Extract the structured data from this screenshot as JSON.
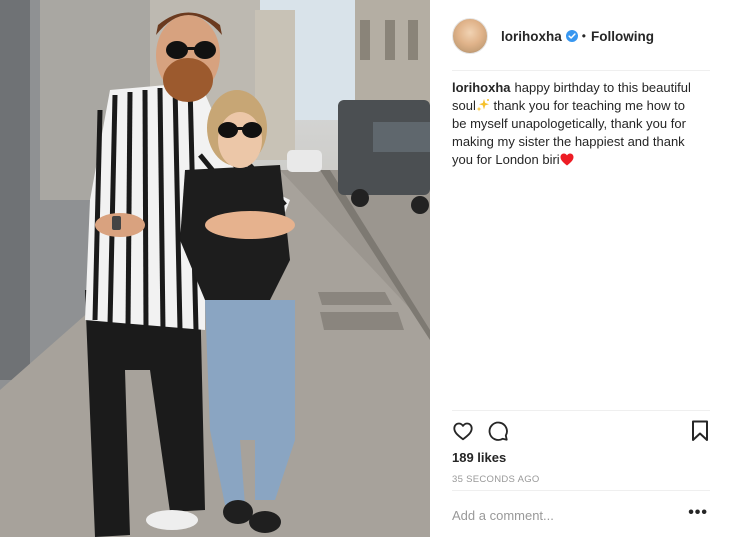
{
  "post": {
    "username": "lorihoxha",
    "follow_state": "Following",
    "separator": "•",
    "caption_user": "lorihoxha",
    "caption_part1": "happy birthday to this beautiful soul",
    "caption_part2": " thank you for teaching me how to be myself unapologetically, thank you for making my sister the happiest and thank you for London biri",
    "likes": "189 likes",
    "timestamp": "35 SECONDS AGO"
  },
  "comment": {
    "placeholder": "Add a comment...",
    "more_label": "•••"
  },
  "icons": {
    "verified": "verified-badge-icon",
    "like": "heart-outline-icon",
    "comment": "comment-bubble-icon",
    "save": "bookmark-icon",
    "sparkle_emoji": "sparkles-emoji",
    "heart_emoji": "red-heart-emoji"
  },
  "colors": {
    "verified_blue": "#3897f0",
    "heart_red": "#ed1c24",
    "muted_text": "#999999"
  }
}
